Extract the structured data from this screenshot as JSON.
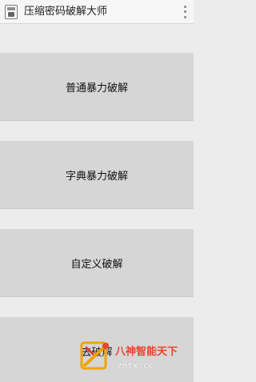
{
  "app_bar": {
    "title": "压缩密码破解大师",
    "icon": "zip-lock-icon",
    "overflow_icon": "overflow-menu-icon"
  },
  "menu": [
    {
      "label": "普通暴力破解"
    },
    {
      "label": "字典暴力破解"
    },
    {
      "label": "自定义破解"
    },
    {
      "label": "去破解"
    }
  ],
  "watermark": {
    "line1": "八神智能天下",
    "line2": "zntx.cc"
  },
  "colors": {
    "background": "#ececec",
    "button": "#d6d6d6",
    "action_bar": "#f6f6f6",
    "watermark_red": "#e8442f",
    "watermark_gold": "#f0a400"
  }
}
